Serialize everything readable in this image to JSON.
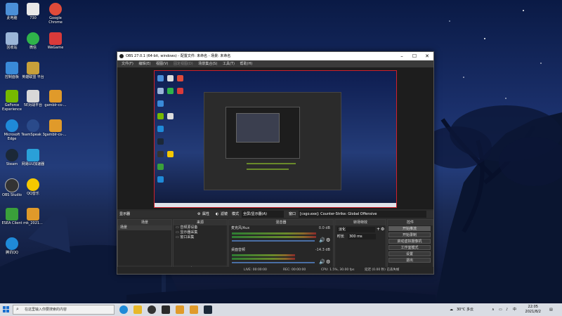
{
  "desktop": {
    "icons": [
      {
        "label": "此电脑",
        "color": "#4b8fd8"
      },
      {
        "label": "730",
        "color": "#e8e8e8"
      },
      {
        "label": "Google Chrome",
        "color": "#e04b3a"
      },
      {
        "label": "回收站",
        "color": "#9bb5d8"
      },
      {
        "label": "微信",
        "color": "#2fb34a"
      },
      {
        "label": "WeGame",
        "color": "#d93a3a"
      },
      {
        "label": "控制面板",
        "color": "#3a8ad8"
      },
      {
        "label": "英雄联盟 平台",
        "color": "#c8a03a"
      },
      {
        "label": "GeForce Experience",
        "color": "#76b900"
      },
      {
        "label": "5E对战平台",
        "color": "#d8d8d8"
      },
      {
        "label": "gamblr-cs-...",
        "color": "#e09a2a"
      },
      {
        "label": "Microsoft Edge",
        "color": "#1f8ad8"
      },
      {
        "label": "TeamSpeak 3",
        "color": "#2a4a8a"
      },
      {
        "label": "gamblr-cs-...",
        "color": "#e09a2a"
      },
      {
        "label": "Steam",
        "color": "#1b2838"
      },
      {
        "label": "网易UU加速器",
        "color": "#2aa0d8"
      },
      {
        "label": "OBS Studio",
        "color": "#333333"
      },
      {
        "label": "QQ音乐",
        "color": "#f5c800"
      },
      {
        "label": "ESEA Client",
        "color": "#3aa03a"
      },
      {
        "label": "mk_2021...",
        "color": "#e09a2a"
      },
      {
        "label": "腾讯QQ",
        "color": "#1f8ad8"
      }
    ]
  },
  "obs": {
    "title": "OBS 27.0.1 (64-bit, windows) - 配置文件: 未命名 - 场景: 未命名",
    "menu": [
      "文件(F)",
      "编辑(E)",
      "视图(V)",
      "固定视图(D)",
      "场景集合(S)",
      "工具(T)",
      "帮助(H)"
    ],
    "context_bar": {
      "source_label": "显示器",
      "properties_label": "属性",
      "filters_label": "滤镜",
      "mode_label": "模式",
      "mode_value": "全屏/显示器(A)",
      "exclude_label": "窗口",
      "exclude_value": "[csgo.exe]: Counter-Strike: Global Offensive"
    },
    "docks": {
      "scenes": {
        "header": "场景",
        "items": [
          "场景"
        ]
      },
      "sources": {
        "header": "来源",
        "items": [
          "音频源设备",
          "显示器采集",
          "窗口采集"
        ]
      },
      "mixer": {
        "header": "混音器",
        "channels": [
          {
            "name": "麦克风/Aux",
            "db": "0.0 dB",
            "level": 0.8
          },
          {
            "name": "桌面音频",
            "db": "-14.3 dB",
            "level": 0.55
          }
        ]
      },
      "transitions": {
        "header": "转场特效",
        "type_value": "淡化",
        "duration_label": "时长",
        "duration_value": "300 ms"
      },
      "controls": {
        "header": "控件",
        "buttons": [
          "开始推流",
          "开始录制",
          "启动虚拟摄像机",
          "工作室模式",
          "设置",
          "退出"
        ]
      }
    },
    "status": {
      "live": "LIVE: 00:00:00",
      "rec": "REC: 00:00:00",
      "cpu": "CPU: 1.5%, 30.00 fps",
      "extra": "延迟 (0.00 秒) 已丢失帧"
    }
  },
  "taskbar": {
    "search_placeholder": "在这里输入你要搜索的内容",
    "weather": "30°C 多云",
    "time": "22:05",
    "date": "2021/8/2"
  },
  "colors": {
    "accent_red": "#d0202a",
    "obs_bg": "#2b2b2b"
  }
}
